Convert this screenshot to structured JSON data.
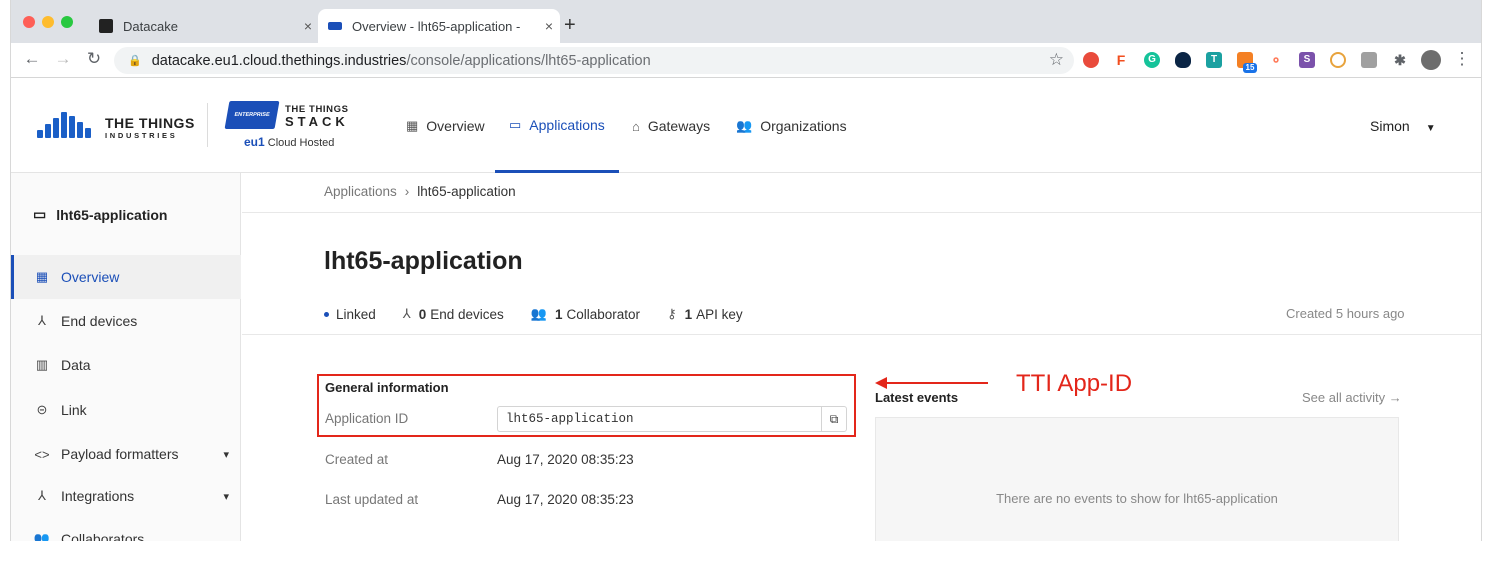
{
  "browser": {
    "tabs": [
      {
        "title": "Datacake",
        "favicon_color": "#222222"
      },
      {
        "title": "Overview - lht65-application -",
        "favicon_color": "#1b4fb8"
      }
    ],
    "new_tab_label": "+",
    "close_label": "×",
    "url_host": "datacake.eu1.cloud.thethings.industries",
    "url_path": "/console/applications/lht65-application",
    "extension_badge": "15"
  },
  "header": {
    "logo_line1": "THE THINGS",
    "logo_line2": "INDUSTRIES",
    "stack_badge": "ENTERPRISE",
    "stack_line1": "THE THINGS",
    "stack_line2": "STACK",
    "cloud_region": "eu1",
    "cloud_label": "Cloud Hosted",
    "nav": [
      {
        "label": "Overview",
        "icon": "dashboard-icon"
      },
      {
        "label": "Applications",
        "icon": "window-icon"
      },
      {
        "label": "Gateways",
        "icon": "router-icon"
      },
      {
        "label": "Organizations",
        "icon": "people-icon"
      }
    ],
    "user": "Simon"
  },
  "sidebar": {
    "title": "lht65-application",
    "items": [
      {
        "label": "Overview"
      },
      {
        "label": "End devices"
      },
      {
        "label": "Data"
      },
      {
        "label": "Link"
      },
      {
        "label": "Payload formatters"
      },
      {
        "label": "Integrations"
      },
      {
        "label": "Collaborators"
      }
    ]
  },
  "breadcrumb": {
    "parent": "Applications",
    "current": "lht65-application"
  },
  "main": {
    "title": "lht65-application",
    "status": {
      "linked": "Linked",
      "end_devices_count": "0",
      "end_devices_label": "End devices",
      "collaborators_count": "1",
      "collaborators_label": "Collaborator",
      "api_keys_count": "1",
      "api_keys_label": "API key"
    },
    "created": "Created 5 hours ago",
    "general_heading": "General information",
    "app_id_label": "Application ID",
    "app_id_value": "lht65-application",
    "created_at_label": "Created at",
    "created_at_value": "Aug 17, 2020 08:35:23",
    "updated_label": "Last updated at",
    "updated_value": "Aug 17, 2020 08:35:23"
  },
  "events": {
    "title": "Latest events",
    "see_all": "See all activity →",
    "empty": "There are no events to show for lht65-application"
  },
  "annotation": {
    "label": "TTI App-ID",
    "color": "#e3261a"
  }
}
